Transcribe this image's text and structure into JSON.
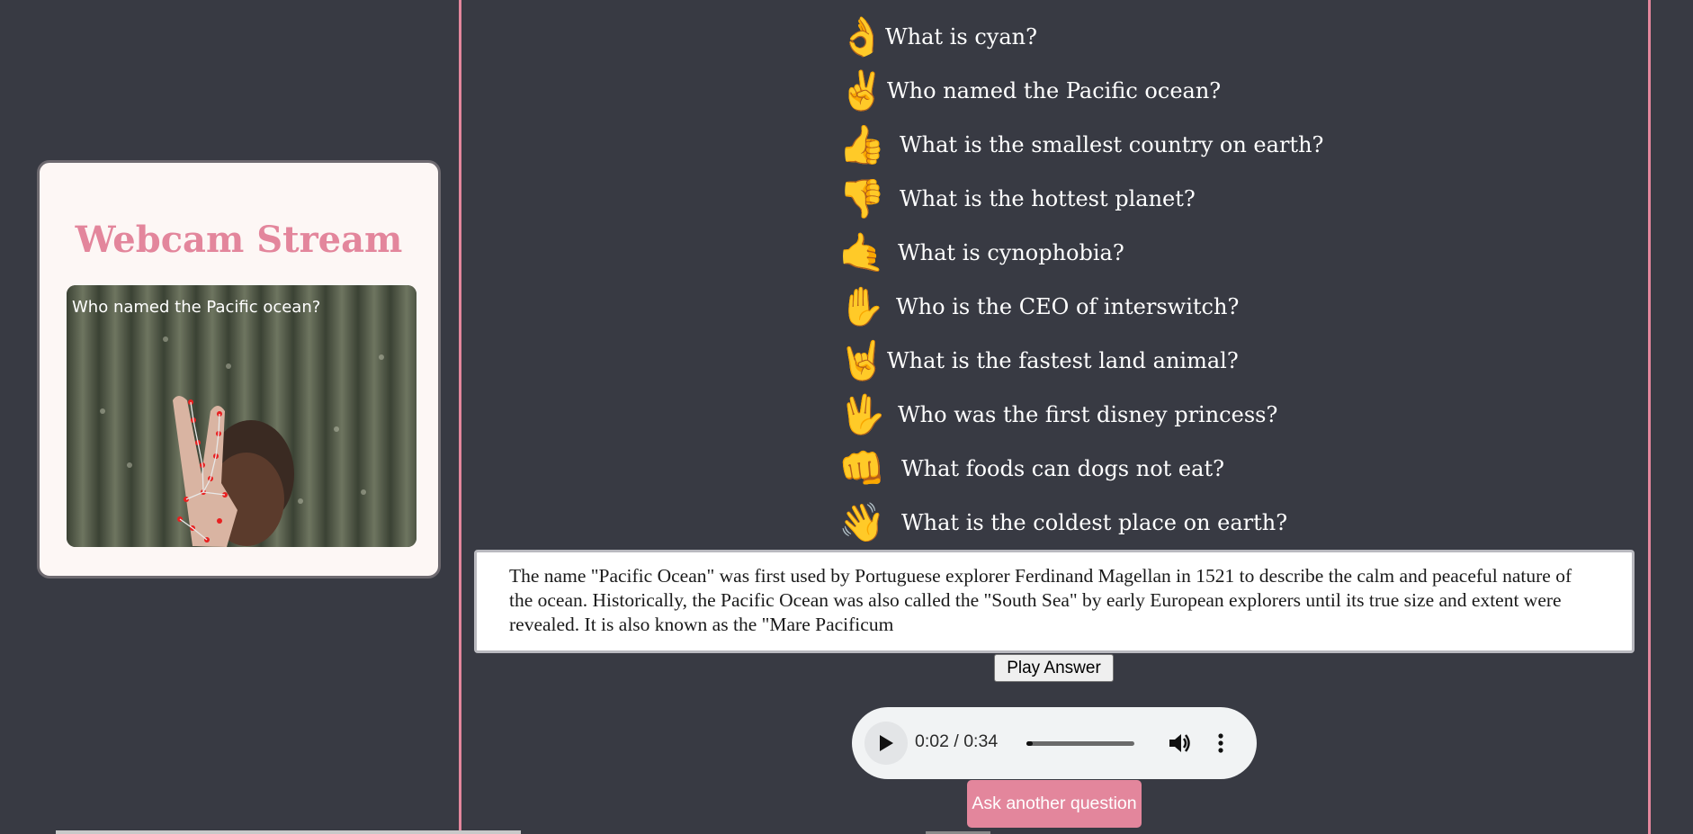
{
  "webcam": {
    "title": "Webcam Stream",
    "overlay_text": "Who named the Pacific ocean?"
  },
  "questions": [
    {
      "gesture_icon": "ok-hand-icon",
      "glyph": "👌",
      "text": "What is cyan?"
    },
    {
      "gesture_icon": "victory-hand-icon",
      "glyph": "✌",
      "text": "Who named the Pacific ocean?"
    },
    {
      "gesture_icon": "thumbs-up-icon",
      "glyph": "👍",
      "text": "What is the smallest country on earth?"
    },
    {
      "gesture_icon": "thumbs-down-icon",
      "glyph": "👎",
      "text": "What is the hottest planet?"
    },
    {
      "gesture_icon": "call-me-hand-icon",
      "glyph": "🤙",
      "text": "What is cynophobia?"
    },
    {
      "gesture_icon": "raised-hand-icon",
      "glyph": "✋",
      "text": "Who is the CEO of interswitch?"
    },
    {
      "gesture_icon": "horns-hand-icon",
      "glyph": "🤘",
      "text": "What is the fastest land animal?"
    },
    {
      "gesture_icon": "vulcan-salute-icon",
      "glyph": "🖖",
      "text": "Who was the first disney princess?"
    },
    {
      "gesture_icon": "fist-icon",
      "glyph": "👊",
      "text": "What foods can dogs not eat?"
    },
    {
      "gesture_icon": "waving-hand-icon",
      "glyph": "👋",
      "text": "What is the coldest place on earth?"
    }
  ],
  "answer": {
    "text": "The name \"Pacific Ocean\" was first used by Portuguese explorer Ferdinand Magellan in 1521 to describe the calm and peaceful nature of the ocean. Historically, the Pacific Ocean was also called the \"South Sea\" by early European explorers until its true size and extent were revealed. It is also known as the \"Mare Pacificum"
  },
  "play_answer_label": "Play Answer",
  "audio": {
    "time": "0:02 / 0:34",
    "progress": 0.06
  },
  "ask_button_label": "Ask another question",
  "colors": {
    "background": "#383a43",
    "accent": "#e3869c",
    "card": "#fdf7f5"
  }
}
